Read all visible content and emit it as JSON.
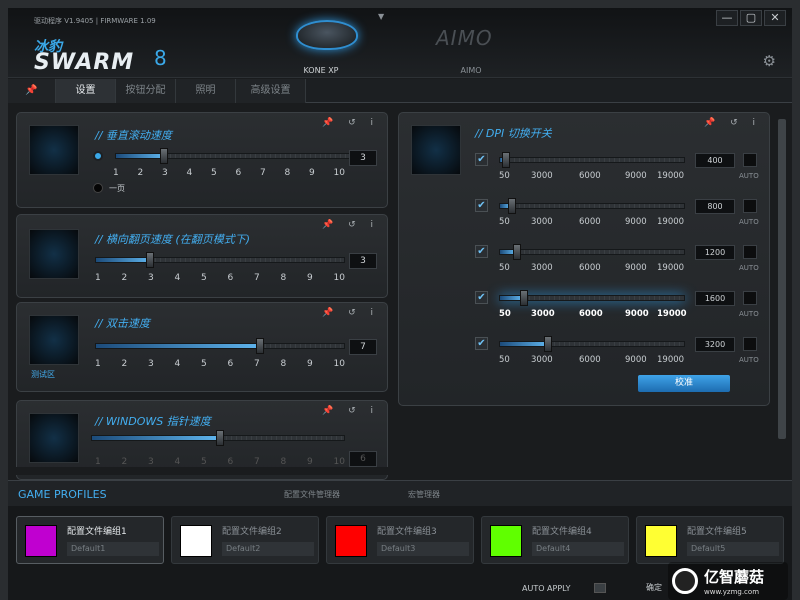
{
  "app": {
    "version_text": "驱动程序 V1.9405 | FIRMWARE 1.09",
    "logo_cn": "冰豹",
    "logo_en": "SWARM",
    "logo_mark": "8"
  },
  "devices": [
    {
      "name": "KONE XP",
      "active": true
    },
    {
      "name": "AIMO",
      "logo": "AIMO",
      "active": false
    }
  ],
  "window_buttons": [
    "—",
    "▢",
    "✕"
  ],
  "tabs": [
    {
      "label": "📌"
    },
    {
      "label": "设置",
      "active": true
    },
    {
      "label": "按钮分配"
    },
    {
      "label": "照明"
    },
    {
      "label": "高级设置"
    }
  ],
  "panels": {
    "scroll": {
      "title": "// 垂直滚动速度",
      "value": "3",
      "ticks": [
        "1",
        "2",
        "3",
        "4",
        "5",
        "6",
        "7",
        "8",
        "9",
        "10"
      ],
      "level": 3,
      "option_page": "一页"
    },
    "tilt": {
      "title": "// 横向翻页速度 (在翻页模式下)",
      "value": "3",
      "ticks": [
        "1",
        "2",
        "3",
        "4",
        "5",
        "6",
        "7",
        "8",
        "9",
        "10"
      ],
      "level": 3
    },
    "dbl": {
      "title": "// 双击速度",
      "value": "7",
      "ticks": [
        "1",
        "2",
        "3",
        "4",
        "5",
        "6",
        "7",
        "8",
        "9",
        "10"
      ],
      "level": 7,
      "test_label": "测试区"
    },
    "ptr": {
      "title": "// WINDOWS 指针速度",
      "value": "6",
      "ticks": [
        "1",
        "2",
        "3",
        "4",
        "5",
        "6",
        "7",
        "8",
        "9",
        "10"
      ],
      "level": 6
    },
    "icons": "📌 ↺ i"
  },
  "dpi": {
    "title": "// DPI 切换开关",
    "ticks": [
      "50",
      "3000",
      "6000",
      "9000",
      "19000"
    ],
    "rows": [
      {
        "value": "400",
        "checked": true
      },
      {
        "value": "800",
        "checked": true
      },
      {
        "value": "1200",
        "checked": true
      },
      {
        "value": "1600",
        "checked": true
      },
      {
        "value": "3200",
        "checked": true
      }
    ],
    "auto_label": "AUTO",
    "calibrate": "校准"
  },
  "bottom": {
    "title": "GAME PROFILES",
    "tabs": [
      "配置文件管理器",
      "宏管理器"
    ],
    "profiles": [
      {
        "name": "配置文件编组1",
        "default": "Default1",
        "color": "#c000d0"
      },
      {
        "name": "配置文件编组2",
        "default": "Default2",
        "color": "#ffffff"
      },
      {
        "name": "配置文件编组3",
        "default": "Default3",
        "color": "#ff0000"
      },
      {
        "name": "配置文件编组4",
        "default": "Default4",
        "color": "#60ff00"
      },
      {
        "name": "配置文件编组5",
        "default": "Default5",
        "color": "#ffff33"
      }
    ],
    "auto_apply": "AUTO APPLY",
    "confirm": "确定"
  },
  "watermark": {
    "title": "亿智蘑菇",
    "url": "www.yzmg.com"
  }
}
